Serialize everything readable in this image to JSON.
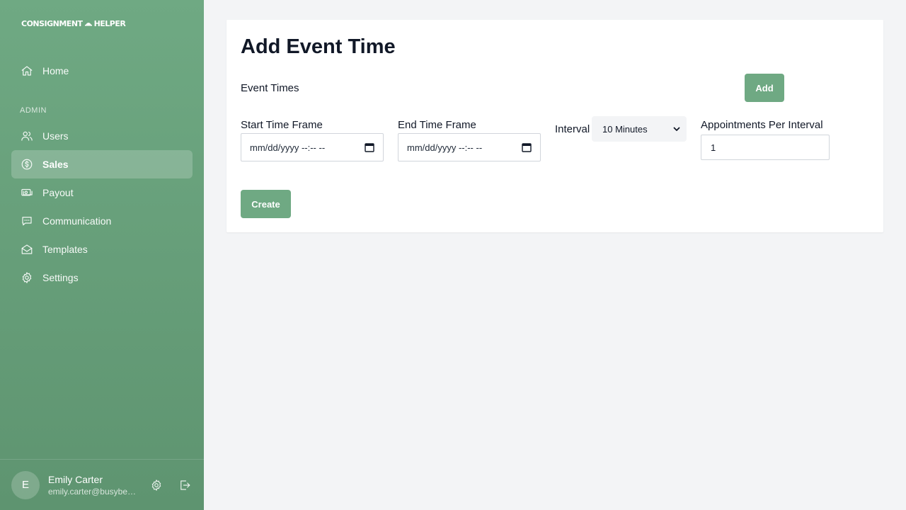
{
  "app": {
    "logo_text": "CONSIGNMENT",
    "logo_text_2": "HELPER"
  },
  "sidebar": {
    "section_label": "ADMIN",
    "items": [
      {
        "label": "Home",
        "icon": "home-icon"
      },
      {
        "label": "Users",
        "icon": "users-icon"
      },
      {
        "label": "Sales",
        "icon": "dollar-circle-icon",
        "active": true
      },
      {
        "label": "Payout",
        "icon": "cash-icon"
      },
      {
        "label": "Communication",
        "icon": "chat-bubble-icon"
      },
      {
        "label": "Templates",
        "icon": "envelope-open-icon"
      },
      {
        "label": "Settings",
        "icon": "gear-icon"
      }
    ]
  },
  "user": {
    "initial": "E",
    "name": "Emily Carter",
    "email": "emily.carter@busybee.com"
  },
  "main": {
    "title": "Add Event Time",
    "section_title": "Event Times",
    "add_label": "Add",
    "create_label": "Create",
    "start": {
      "label": "Start Time Frame",
      "value": "mm/dd/yyyy --:-- --"
    },
    "end": {
      "label": "End Time Frame",
      "value": "mm/dd/yyyy --:-- --"
    },
    "interval": {
      "label": "Interval",
      "value": "10 Minutes"
    },
    "appointments": {
      "label": "Appointments Per Interval",
      "value": "1"
    }
  },
  "colors": {
    "brand": "#6fa983",
    "sidebar_bottom": "#5e9470",
    "page_bg": "#f3f4f6"
  }
}
